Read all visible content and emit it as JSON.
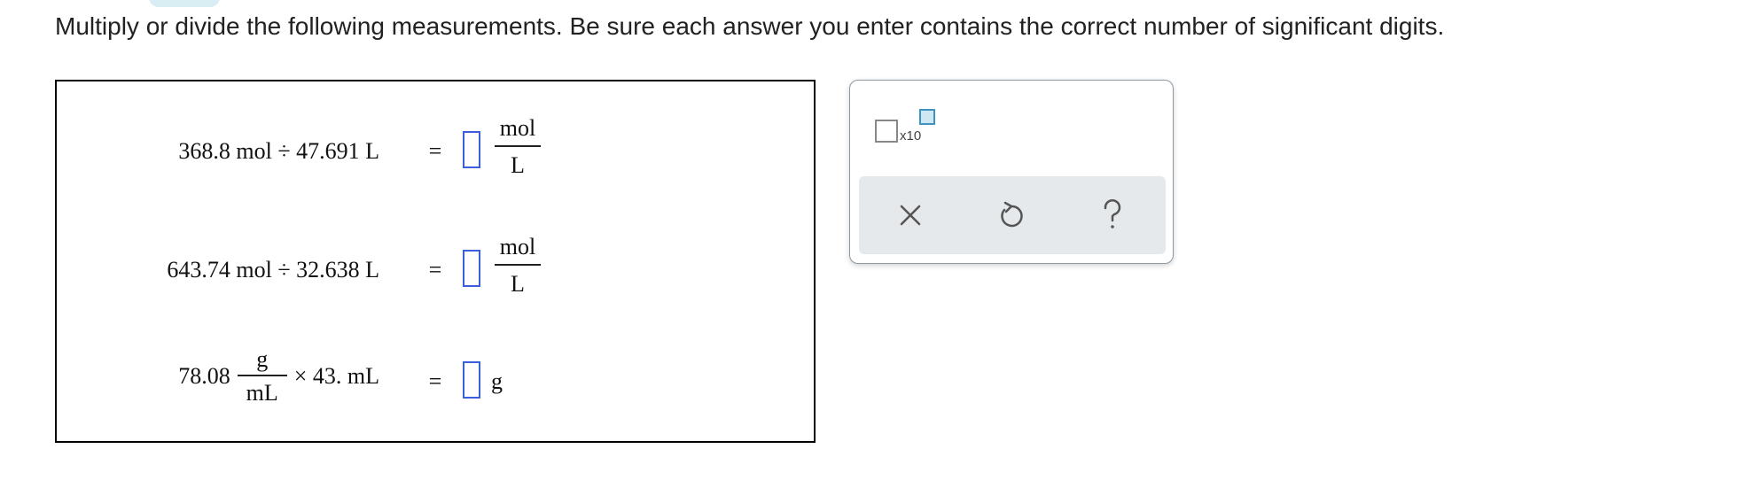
{
  "instructions": "Multiply or divide the following measurements. Be sure each answer you enter contains the correct number of significant digits.",
  "problems": [
    {
      "expression": "368.8 mol ÷ 47.691 L",
      "equals": "=",
      "answer_value": "",
      "unit_numerator": "mol",
      "unit_denominator": "L"
    },
    {
      "expression": "643.74 mol ÷ 32.638 L",
      "equals": "=",
      "answer_value": "",
      "unit_numerator": "mol",
      "unit_denominator": "L"
    },
    {
      "lead_value": "78.08",
      "lead_unit_numerator": "g",
      "lead_unit_denominator": "mL",
      "tail": "× 43. mL",
      "equals": "=",
      "answer_value": "",
      "unit": "g"
    }
  ],
  "toolbar": {
    "x10_label": "x10",
    "x10_icon": "scientific-notation-icon",
    "clear_icon": "close-icon",
    "undo_icon": "undo-icon",
    "help_icon": "help-icon"
  },
  "colors": {
    "answer_border": "#3a5fd9",
    "exponent_fill": "#cfe7f2",
    "exponent_border": "#3d93c2",
    "toolbar_bg": "#e6e9eb",
    "icon_color": "#555555"
  }
}
